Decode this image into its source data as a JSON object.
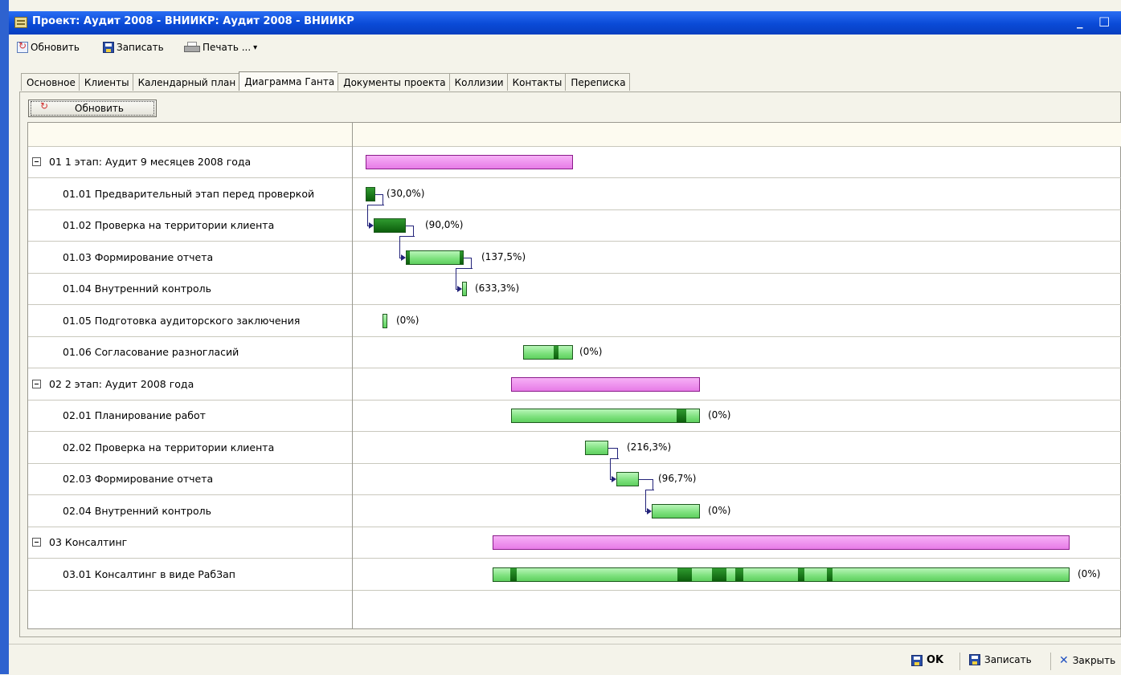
{
  "window": {
    "title": "Проект: Аудит 2008 - ВНИИКР: Аудит 2008 - ВНИИКР",
    "controls": [
      "_",
      "□",
      "×"
    ]
  },
  "toolbar": {
    "refresh": "Обновить",
    "save": "Записать",
    "print": "Печать ...",
    "dropdown": "▾"
  },
  "tabs": [
    "Основное",
    "Клиенты",
    "Календарный план",
    "Диаграмма Ганта",
    "Документы проекта",
    "Коллизии",
    "Контакты",
    "Переписка"
  ],
  "active_tab": "Диаграмма Ганта",
  "gantt_refresh": "Обновить",
  "rows": [
    {
      "name": "01 1 этап: Аудит 9 месяцев 2008 года",
      "summary": true,
      "pct": ""
    },
    {
      "name": "01.01 Предварительный этап перед проверкой",
      "summary": false,
      "pct": "(30,0%)"
    },
    {
      "name": "01.02 Проверка на территории клиента",
      "summary": false,
      "pct": "(90,0%)"
    },
    {
      "name": "01.03 Формирование отчета",
      "summary": false,
      "pct": "(137,5%)"
    },
    {
      "name": "01.04 Внутренний контроль",
      "summary": false,
      "pct": "(633,3%)"
    },
    {
      "name": "01.05 Подготовка аудиторского заключения",
      "summary": false,
      "pct": "(0%)"
    },
    {
      "name": "01.06 Согласование разногласий",
      "summary": false,
      "pct": "(0%)"
    },
    {
      "name": "02 2 этап: Аудит 2008 года",
      "summary": true,
      "pct": ""
    },
    {
      "name": "02.01 Планирование работ",
      "summary": false,
      "pct": "(0%)"
    },
    {
      "name": "02.02 Проверка на территории клиента",
      "summary": false,
      "pct": "(216,3%)"
    },
    {
      "name": "02.03 Формирование отчета",
      "summary": false,
      "pct": "(96,7%)"
    },
    {
      "name": "02.04 Внутренний контроль",
      "summary": false,
      "pct": "(0%)"
    },
    {
      "name": "03 Консалтинг",
      "summary": true,
      "pct": ""
    },
    {
      "name": "03.01 Консалтинг в виде РабЗап",
      "summary": false,
      "pct": "(0%)"
    }
  ],
  "footer": {
    "ok": "OK",
    "save": "Записать",
    "close": "Закрыть"
  },
  "colors": {
    "summary_bar": "#ee82ee",
    "task_bar": "#7be07b",
    "task_bar_done": "#0c5e0c",
    "link": "#23237a",
    "title_bar": "#0a4ad7"
  }
}
